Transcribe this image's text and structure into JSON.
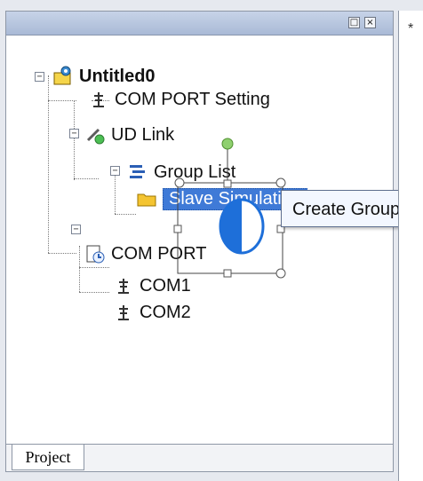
{
  "panel": {
    "close_glyph": "×",
    "pin_glyph": "□",
    "tab_label": "Project"
  },
  "tree": {
    "root": {
      "label": "Untitled0",
      "icon": "project-icon"
    },
    "com_port_setting": {
      "label": "COM PORT Setting",
      "icon": "port-setting-icon"
    },
    "ud_link": {
      "label": "UD Link",
      "icon": "link-icon"
    },
    "group_list": {
      "label": "Group List",
      "icon": "group-list-icon"
    },
    "slave": {
      "label": "Slave Simulation",
      "icon": "folder-icon"
    },
    "com_port": {
      "label": "COM PORT",
      "icon": "com-port-icon"
    },
    "com1": {
      "label": "COM1",
      "icon": "port-icon"
    },
    "com2": {
      "label": "COM2",
      "icon": "port-icon"
    }
  },
  "tooltip": {
    "label": "Create Group"
  },
  "right_panel": {
    "marker": "*"
  },
  "colors": {
    "selection": "#3f7ad7",
    "pie_fill": "#1e6fd9",
    "handle": "#6fa04b"
  }
}
